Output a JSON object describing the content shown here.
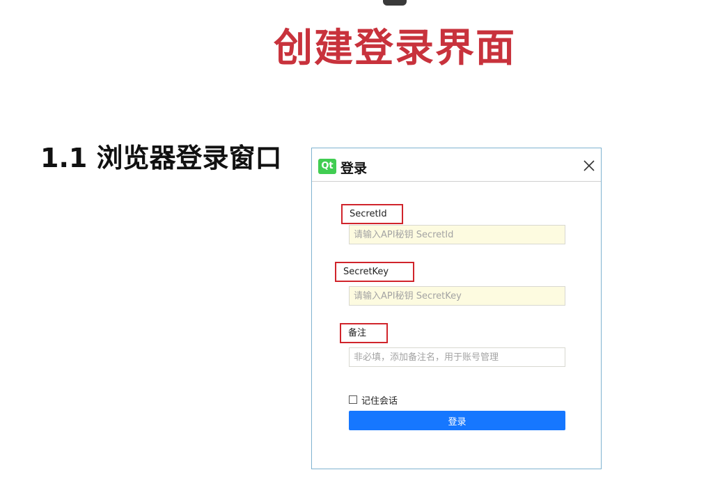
{
  "slide": {
    "title": "创建登录界面",
    "section_heading": "1.1 浏览器登录窗口"
  },
  "dialog": {
    "logo_text": "Qt",
    "title": "登录",
    "close_icon": "close-icon",
    "fields": [
      {
        "label": "SecretId",
        "placeholder": "请输入API秘钥 SecretId"
      },
      {
        "label": "SecretKey",
        "placeholder": "请输入API秘钥 SecretKey"
      },
      {
        "label": "备注",
        "placeholder": "非必填，添加备注名，用于账号管理"
      }
    ],
    "remember_label": "记住会话",
    "remember_checked": false,
    "login_button": "登录"
  },
  "colors": {
    "title_red": "#c8323c",
    "highlight_red": "#d0242b",
    "button_blue": "#1677ff",
    "qt_green": "#41cd52",
    "input_yellow": "#fdfbe0"
  }
}
